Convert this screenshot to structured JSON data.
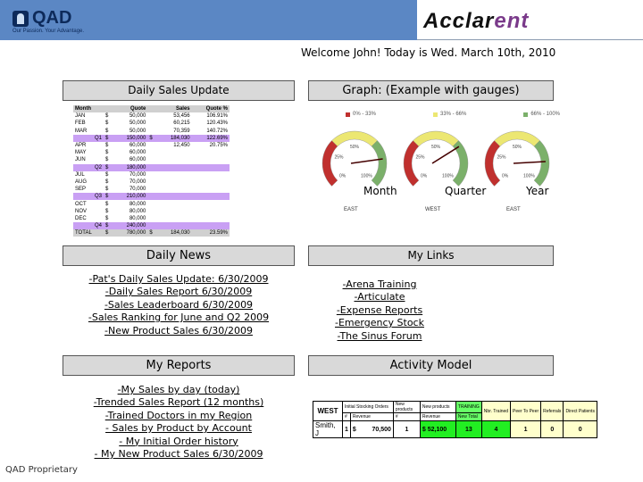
{
  "header": {
    "qad_logo": "QAD",
    "qad_tagline": "Our Passion. Your Advantage.",
    "partner_logo": "Acclarent",
    "welcome": "Welcome John! Today is Wed. March 10th, 2010"
  },
  "sales": {
    "title": "Daily Sales Update",
    "columns": [
      "Month",
      "Quote",
      "Sales",
      "Quote %"
    ],
    "rows": [
      {
        "m": "JAN",
        "cur": "$",
        "quote": "50,000",
        "cur2": "",
        "sales": "53,456",
        "pct": "106.91%",
        "type": "row"
      },
      {
        "m": "FEB",
        "cur": "$",
        "quote": "50,000",
        "cur2": "",
        "sales": "60,215",
        "pct": "120.43%",
        "type": "row"
      },
      {
        "m": "MAR",
        "cur": "$",
        "quote": "50,000",
        "cur2": "",
        "sales": "70,359",
        "pct": "140.72%",
        "type": "row"
      },
      {
        "m": "Q1",
        "cur": "$",
        "quote": "150,000",
        "cur2": "$",
        "sales": "184,030",
        "pct": "122.69%",
        "type": "q"
      },
      {
        "m": "APR",
        "cur": "$",
        "quote": "60,000",
        "cur2": "",
        "sales": "12,450",
        "pct": "20.75%",
        "type": "row"
      },
      {
        "m": "MAY",
        "cur": "$",
        "quote": "60,000",
        "cur2": "",
        "sales": "",
        "pct": "",
        "type": "row"
      },
      {
        "m": "JUN",
        "cur": "$",
        "quote": "60,000",
        "cur2": "",
        "sales": "",
        "pct": "",
        "type": "row"
      },
      {
        "m": "Q2",
        "cur": "$",
        "quote": "180,000",
        "cur2": "",
        "sales": "",
        "pct": "",
        "type": "q"
      },
      {
        "m": "JUL",
        "cur": "$",
        "quote": "70,000",
        "cur2": "",
        "sales": "",
        "pct": "",
        "type": "row"
      },
      {
        "m": "AUG",
        "cur": "$",
        "quote": "70,000",
        "cur2": "",
        "sales": "",
        "pct": "",
        "type": "row"
      },
      {
        "m": "SEP",
        "cur": "$",
        "quote": "70,000",
        "cur2": "",
        "sales": "",
        "pct": "",
        "type": "row"
      },
      {
        "m": "Q3",
        "cur": "$",
        "quote": "210,000",
        "cur2": "",
        "sales": "",
        "pct": "",
        "type": "q"
      },
      {
        "m": "OCT",
        "cur": "$",
        "quote": "80,000",
        "cur2": "",
        "sales": "",
        "pct": "",
        "type": "row"
      },
      {
        "m": "NOV",
        "cur": "$",
        "quote": "80,000",
        "cur2": "",
        "sales": "",
        "pct": "",
        "type": "row"
      },
      {
        "m": "DEC",
        "cur": "$",
        "quote": "80,000",
        "cur2": "",
        "sales": "",
        "pct": "",
        "type": "row"
      },
      {
        "m": "Q4",
        "cur": "$",
        "quote": "240,000",
        "cur2": "",
        "sales": "",
        "pct": "",
        "type": "q"
      },
      {
        "m": "TOTAL",
        "cur": "$",
        "quote": "780,000",
        "cur2": "$",
        "sales": "184,030",
        "pct": "23.59%",
        "type": "t"
      }
    ]
  },
  "graph": {
    "title": "Graph:  (Example with gauges)",
    "legend": [
      {
        "label": "0% - 33%",
        "color": "#c0302e"
      },
      {
        "label": "33% - 66%",
        "color": "#ece772"
      },
      {
        "label": "66% - 100%",
        "color": "#7bb06a"
      }
    ],
    "gauges": [
      {
        "label": "Month",
        "region": "EAST",
        "value": 0.8,
        "ticks": [
          "0%",
          "25%",
          "50%",
          "100%"
        ]
      },
      {
        "label": "Quarter",
        "region": "WEST",
        "value": 0.7,
        "ticks": [
          "0%",
          "25%",
          "50%",
          "100%"
        ]
      },
      {
        "label": "Year",
        "region": "EAST",
        "value": 0.82,
        "ticks": [
          "0%",
          "25%",
          "50%",
          "100%"
        ]
      }
    ]
  },
  "news": {
    "title": "Daily News",
    "items": [
      "-Pat's Daily Sales Update:  6/30/2009",
      "-Daily Sales Report 6/30/2009",
      "-Sales Leaderboard 6/30/2009",
      "-Sales Ranking for June and Q2 2009",
      "-New Product Sales 6/30/2009"
    ]
  },
  "links": {
    "title": "My Links",
    "items": [
      "-Arena Training",
      "-Articulate",
      "-Expense Reports",
      "-Emergency Stock",
      "-The Sinus Forum"
    ]
  },
  "reports": {
    "title": "My Reports",
    "items": [
      "-My Sales by day (today)",
      "-Trended Sales Report (12 months)",
      "-Trained Doctors in my Region",
      "- Sales by Product by Account",
      "- My Initial Order history",
      "- My New Product Sales 6/30/2009"
    ]
  },
  "activity": {
    "title": "Activity Model",
    "region": "WEST",
    "headers": [
      "Initial Stocking Orders",
      "New products",
      "New products",
      "TRAINING",
      "Nbr. Trained",
      "Peer To Peer",
      "Referrals",
      "Direct Patients"
    ],
    "subheaders": [
      "#",
      "Revenue",
      "#",
      "Revenue",
      "New Total"
    ],
    "row": {
      "name": "Smith, J",
      "orders": "1",
      "cur": "$",
      "revenue": "70,500",
      "new_count": "1",
      "new_revenue": "$   52,100",
      "training": "13",
      "trained": "4",
      "peer": "1",
      "referrals": "0",
      "direct": "0"
    }
  },
  "footer": {
    "text": "QAD Proprietary"
  }
}
